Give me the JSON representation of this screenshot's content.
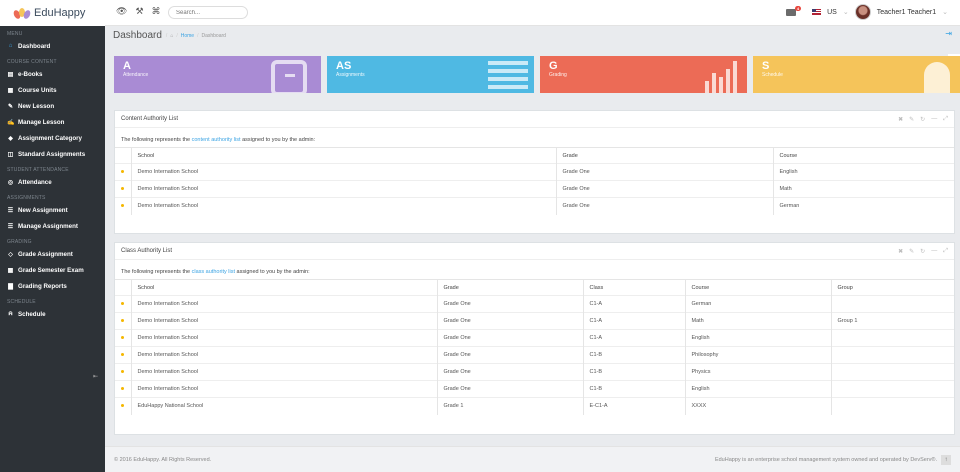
{
  "brand": {
    "name": "EduHappy"
  },
  "search": {
    "placeholder": "Search..."
  },
  "topbar": {
    "mail_count": "4",
    "language": "US",
    "user_name": "Teacher1 Teacher1"
  },
  "sidebar": {
    "sections": [
      {
        "label": "MENU",
        "items": [
          {
            "label": "Dashboard",
            "icon": "home-icon",
            "active": true
          }
        ]
      },
      {
        "label": "COURSE CONTENT",
        "items": [
          {
            "label": "e-Books",
            "icon": "book-icon"
          },
          {
            "label": "Course Units",
            "icon": "grid-icon"
          },
          {
            "label": "New Lesson",
            "icon": "pencil-icon"
          },
          {
            "label": "Manage Lesson",
            "icon": "edit-icon"
          },
          {
            "label": "Assignment Category",
            "icon": "tag-icon"
          },
          {
            "label": "Standard Assignments",
            "icon": "columns-icon"
          }
        ]
      },
      {
        "label": "STUDENT ATTENDANCE",
        "items": [
          {
            "label": "Attendance",
            "icon": "circle-icon"
          }
        ]
      },
      {
        "label": "ASSIGNMENTS",
        "items": [
          {
            "label": "New Assignment",
            "icon": "list-icon"
          },
          {
            "label": "Manage Assignment",
            "icon": "list-icon"
          }
        ]
      },
      {
        "label": "GRADING",
        "items": [
          {
            "label": "Grade Assignment",
            "icon": "diamond-icon"
          },
          {
            "label": "Grade Semester Exam",
            "icon": "grid-icon"
          },
          {
            "label": "Grading Reports",
            "icon": "bar-chart-icon"
          }
        ]
      },
      {
        "label": "SCHEDULE",
        "items": [
          {
            "label": "Schedule",
            "icon": "bell-icon"
          }
        ]
      }
    ]
  },
  "page": {
    "title": "Dashboard",
    "breadcrumb": [
      "Home",
      "Dashboard"
    ]
  },
  "tiles": [
    {
      "abbr": "A",
      "label": "Attendance",
      "color": "#a98bd4"
    },
    {
      "abbr": "AS",
      "label": "Assignments",
      "color": "#4fb9e3"
    },
    {
      "abbr": "G",
      "label": "Grading",
      "color": "#ec6b56"
    },
    {
      "abbr": "S",
      "label": "Schedule",
      "color": "#f5c45a"
    }
  ],
  "content_panel": {
    "title": "Content Authority List",
    "intro_prefix": "The following represents the ",
    "intro_link": "content authority list",
    "intro_suffix": " assigned to you by the admin:",
    "columns": [
      "School",
      "Grade",
      "Course"
    ],
    "rows": [
      [
        "Demo Internation School",
        "Grade One",
        "English"
      ],
      [
        "Demo Internation School",
        "Grade One",
        "Math"
      ],
      [
        "Demo Internation School",
        "Grade One",
        "German"
      ]
    ]
  },
  "class_panel": {
    "title": "Class Authority List",
    "intro_prefix": "The following represents the ",
    "intro_link": "class authority list",
    "intro_suffix": " assigned to you by the admin:",
    "columns": [
      "School",
      "Grade",
      "Class",
      "Course",
      "Group"
    ],
    "rows": [
      [
        "Demo Internation School",
        "Grade One",
        "C1-A",
        "German",
        ""
      ],
      [
        "Demo Internation School",
        "Grade One",
        "C1-A",
        "Math",
        "Group 1"
      ],
      [
        "Demo Internation School",
        "Grade One",
        "C1-A",
        "English",
        ""
      ],
      [
        "Demo Internation School",
        "Grade One",
        "C1-B",
        "Philosophy",
        ""
      ],
      [
        "Demo Internation School",
        "Grade One",
        "C1-B",
        "Physics",
        ""
      ],
      [
        "Demo Internation School",
        "Grade One",
        "C1-B",
        "English",
        ""
      ],
      [
        "EduHappy National School",
        "Grade 1",
        "E-C1-A",
        "XXXX",
        ""
      ]
    ]
  },
  "footer": {
    "left": "© 2016 EduHappy. All Rights Reserved.",
    "right": "EduHappy is an enterprise school management system owned and operated by DevServ®."
  }
}
